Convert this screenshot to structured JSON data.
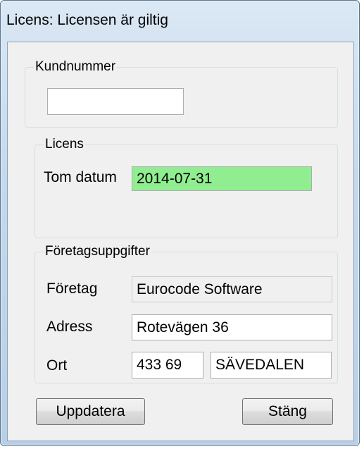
{
  "window": {
    "title": "Licens: Licensen är giltig"
  },
  "kundnummer": {
    "legend": "Kundnummer",
    "value": "",
    "placeholder": ""
  },
  "licens": {
    "legend": "Licens",
    "tom_datum_label": "Tom datum",
    "tom_datum_value": "2014-07-31",
    "status_color": "#90ee90"
  },
  "foretagsuppgifter": {
    "legend": "Företagsuppgifter",
    "foretag_label": "Företag",
    "foretag_value": "Eurocode Software",
    "adress_label": "Adress",
    "adress_value": "Rotevägen 36",
    "ort_label": "Ort",
    "postnummer_value": "433 69",
    "ort_value": "SÄVEDALEN"
  },
  "buttons": {
    "update_label": "Uppdatera",
    "close_label": "Stäng"
  }
}
